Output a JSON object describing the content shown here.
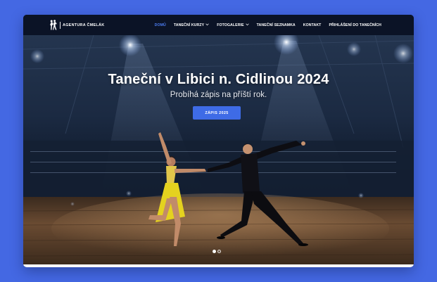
{
  "brand": {
    "name": "AGENTURA ČMELÁK",
    "logo_icon": "dancing-couple-icon"
  },
  "nav": {
    "items": [
      {
        "label": "DOMŮ",
        "active": true,
        "has_dropdown": false
      },
      {
        "label": "TANEČNÍ KURZY",
        "active": false,
        "has_dropdown": true
      },
      {
        "label": "FOTOGALERIE",
        "active": false,
        "has_dropdown": true
      },
      {
        "label": "TANEČNÍ SEZNAMKA",
        "active": false,
        "has_dropdown": false
      },
      {
        "label": "KONTAKT",
        "active": false,
        "has_dropdown": false
      },
      {
        "label": "PŘIHLÁŠENÍ DO TANEČNÍCH",
        "active": false,
        "has_dropdown": false
      }
    ],
    "dropdown_icon": "chevron-down-icon"
  },
  "hero": {
    "title": "Taneční v Libici n. Cidlinou 2024",
    "subtitle": "Probíhá zápis na příští rok.",
    "cta_label": "ZÁPIS 2025",
    "slides": {
      "count": 2,
      "active_index": 0
    }
  },
  "colors": {
    "background": "#4468e3",
    "header": "#0b1326",
    "accent": "#3e6be6",
    "active_nav": "#4b7cf0"
  }
}
